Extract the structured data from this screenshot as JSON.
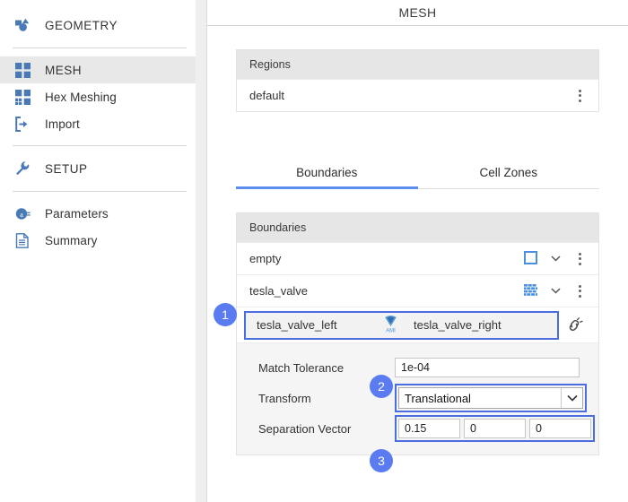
{
  "sidebar": {
    "items": [
      {
        "label": "GEOMETRY",
        "icon": "geometry-shapes-icon",
        "type": "section"
      },
      {
        "label": "MESH",
        "icon": "grid-squares-icon",
        "type": "item",
        "active": true
      },
      {
        "label": "Hex Meshing",
        "icon": "hex-grid-icon",
        "type": "item"
      },
      {
        "label": "Import",
        "icon": "import-arrow-icon",
        "type": "item"
      },
      {
        "label": "SETUP",
        "icon": "wrench-icon",
        "type": "section"
      },
      {
        "label": "Parameters",
        "icon": "parameters-circle-a-icon",
        "type": "item"
      },
      {
        "label": "Summary",
        "icon": "document-icon",
        "type": "item"
      }
    ]
  },
  "main": {
    "title": "MESH",
    "regions": {
      "header": "Regions",
      "rows": [
        {
          "name": "default",
          "menu": "kebab-icon"
        }
      ]
    },
    "tabs": [
      {
        "label": "Boundaries",
        "active": true
      },
      {
        "label": "Cell Zones",
        "active": false
      }
    ],
    "boundaries": {
      "header": "Boundaries",
      "rows": [
        {
          "name": "empty",
          "type_icon": "empty-square-icon"
        },
        {
          "name": "tesla_valve",
          "type_icon": "wall-brick-icon"
        }
      ],
      "pair": {
        "left": "tesla_valve_left",
        "icon": "ami-interface-icon",
        "right": "tesla_valve_right",
        "action_icon": "unlink-icon"
      },
      "form": {
        "match_tolerance": {
          "label": "Match Tolerance",
          "value": "1e-04"
        },
        "transform": {
          "label": "Transform",
          "value": "Translational",
          "arrow_icon": "chevron-down-icon"
        },
        "separation_vector": {
          "label": "Separation Vector",
          "x": "0.15",
          "y": "0",
          "z": "0"
        }
      }
    }
  },
  "callouts": [
    {
      "id": "1",
      "label": "1"
    },
    {
      "id": "2",
      "label": "2"
    },
    {
      "id": "3",
      "label": "3"
    }
  ],
  "colors": {
    "accent_blue": "#5b8def",
    "highlight_blue": "#4a6ee0",
    "badge_blue": "#5b7cf0",
    "icon_blue": "#4a7ab5"
  }
}
